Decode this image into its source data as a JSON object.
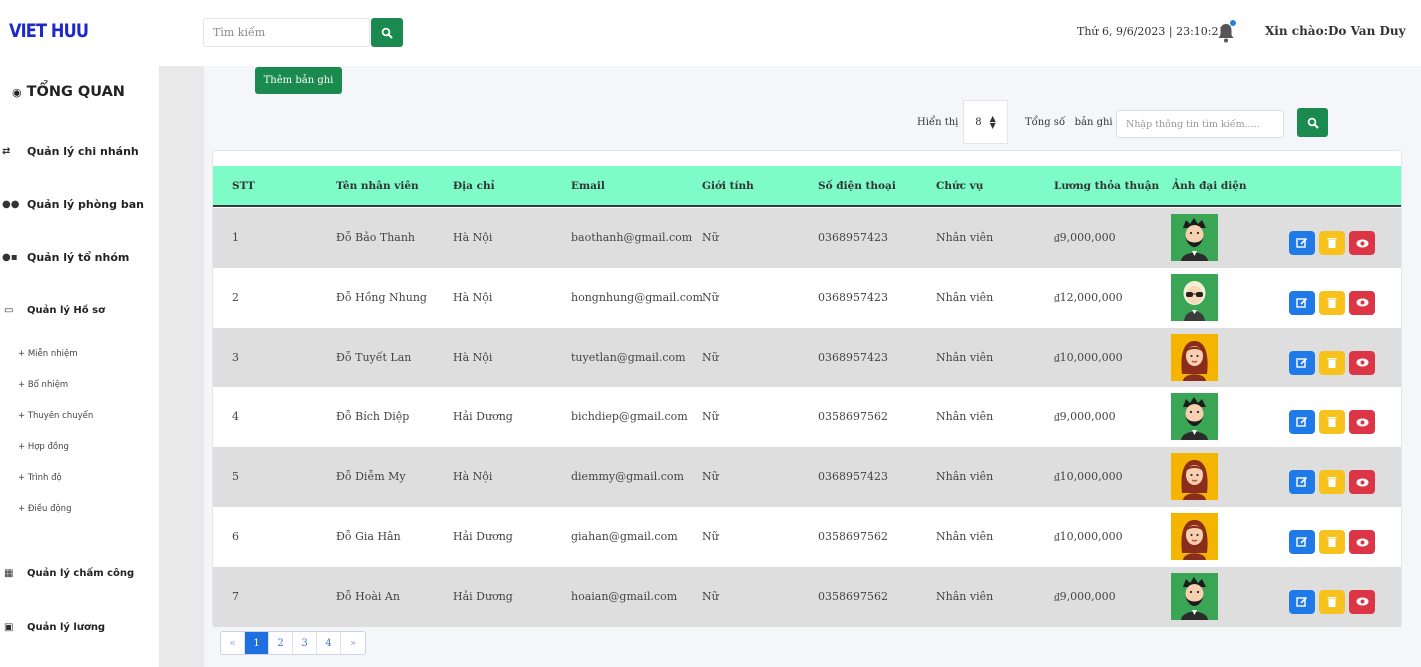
{
  "header": {
    "logo": "VIET HUU",
    "search_placeholder": "Tìm kiếm",
    "datetime": "Thứ 6, 9/6/2023 | 23:10:21",
    "greeting": "Xin chào:Do Van Duy"
  },
  "sidebar": {
    "title": "TỔNG QUAN",
    "items": [
      {
        "label": "Quản lý chi nhánh",
        "icon": "people-arrows-icon"
      },
      {
        "label": "Quản lý phòng ban",
        "icon": "users-icon"
      },
      {
        "label": "Quản lý tổ nhóm",
        "icon": "user-group-icon"
      },
      {
        "label": "Quản lý Hồ sơ",
        "icon": "id-card-icon"
      },
      {
        "label": "Quản lý chấm công",
        "icon": "calendar-icon"
      },
      {
        "label": "Quản lý lương",
        "icon": "money-icon"
      }
    ],
    "subitems": [
      "+ Miễn nhiệm",
      "+ Bổ nhiệm",
      "+ Thuyên chuyển",
      "+ Hợp đồng",
      "+ Trình độ",
      "+ Điều động"
    ]
  },
  "toolbar": {
    "add_label": "Thêm bản ghi",
    "show_label": "Hiển thị",
    "page_size": "8",
    "total_label": "Tổng số   bản ghi",
    "filter_placeholder": "Nhập thông tin tìm kiếm....."
  },
  "table": {
    "columns": [
      "STT",
      "Tên nhân viên",
      "Địa chỉ",
      "Email",
      "Giới tính",
      "Số điện thoại",
      "Chức vụ",
      "Lương thỏa thuận",
      "Ảnh đại diện"
    ],
    "rows": [
      {
        "stt": "1",
        "name": "Đỗ Bảo Thanh",
        "address": "Hà Nội",
        "email": "baothanh@gmail.com",
        "gender": "Nữ",
        "phone": "0368957423",
        "position": "Nhân viên",
        "salary": "₫9,000,000",
        "avatar": "male-dark-hair-avatar",
        "avatar_bg": "#3aa655"
      },
      {
        "stt": "2",
        "name": "Đỗ Hồng Nhung",
        "address": "Hà Nội",
        "email": "hongnhung@gmail.com",
        "gender": "Nữ",
        "phone": "0368957423",
        "position": "Nhân viên",
        "salary": "₫12,000,000",
        "avatar": "sunglasses-avatar",
        "avatar_bg": "#3aa655"
      },
      {
        "stt": "3",
        "name": "Đỗ Tuyết Lan",
        "address": "Hà Nội",
        "email": "tuyetlan@gmail.com",
        "gender": "Nữ",
        "phone": "0368957423",
        "position": "Nhân viên",
        "salary": "₫10,000,000",
        "avatar": "female-avatar",
        "avatar_bg": "#f5b400"
      },
      {
        "stt": "4",
        "name": "Đỗ Bích Diệp",
        "address": "Hải Dương",
        "email": "bichdiep@gmail.com",
        "gender": "Nữ",
        "phone": "0358697562",
        "position": "Nhân viên",
        "salary": "₫9,000,000",
        "avatar": "male-dark-hair-avatar",
        "avatar_bg": "#3aa655"
      },
      {
        "stt": "5",
        "name": "Đỗ Diễm My",
        "address": "Hà Nội",
        "email": "diemmy@gmail.com",
        "gender": "Nữ",
        "phone": "0368957423",
        "position": "Nhân viên",
        "salary": "₫10,000,000",
        "avatar": "female-avatar",
        "avatar_bg": "#f5b400"
      },
      {
        "stt": "6",
        "name": "Đỗ Gia Hân",
        "address": "Hải Dương",
        "email": "giahan@gmail.com",
        "gender": "Nữ",
        "phone": "0358697562",
        "position": "Nhân viên",
        "salary": "₫10,000,000",
        "avatar": "female-avatar",
        "avatar_bg": "#f5b400"
      },
      {
        "stt": "7",
        "name": "Đỗ Hoài An",
        "address": "Hải Dương",
        "email": "hoaian@gmail.com",
        "gender": "Nữ",
        "phone": "0358697562",
        "position": "Nhân viên",
        "salary": "₫9,000,000",
        "avatar": "male-dark-hair-avatar",
        "avatar_bg": "#3aa655"
      }
    ]
  },
  "pagination": {
    "prev": "«",
    "pages": [
      "1",
      "2",
      "3",
      "4"
    ],
    "active": "1",
    "next": "»"
  },
  "colors": {
    "brand": "#1d2ac9",
    "primary_green": "#1a8a4f",
    "table_header": "#7efcc8",
    "edit": "#1f7ae8",
    "delete": "#f7c21b",
    "view": "#dc3545"
  }
}
